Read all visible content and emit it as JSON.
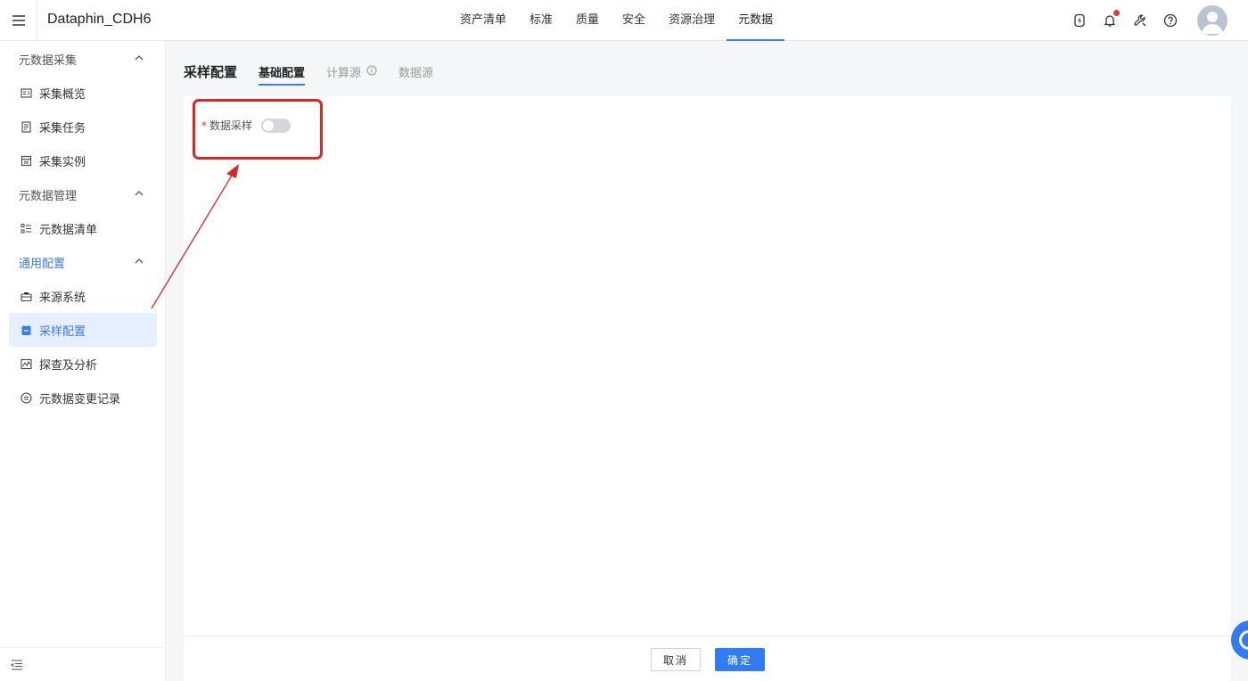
{
  "header": {
    "app_title": "Dataphin_CDH6",
    "nav": [
      {
        "label": "资产清单",
        "active": false
      },
      {
        "label": "标准",
        "active": false
      },
      {
        "label": "质量",
        "active": false
      },
      {
        "label": "安全",
        "active": false
      },
      {
        "label": "资源治理",
        "active": false
      },
      {
        "label": "元数据",
        "active": true
      }
    ],
    "icons": [
      "lightning-icon",
      "bell-icon",
      "wrench-icon",
      "help-icon",
      "avatar"
    ]
  },
  "sidebar": {
    "groups": [
      {
        "label": "元数据采集",
        "items": [
          "采集概览",
          "采集任务",
          "采集实例"
        ]
      },
      {
        "label": "元数据管理",
        "items": [
          "元数据清单"
        ]
      },
      {
        "label": "通用配置",
        "items": [
          "来源系统",
          "采样配置",
          "探查及分析",
          "元数据变更记录"
        ]
      }
    ],
    "active_item": "采样配置"
  },
  "main": {
    "title": "采样配置",
    "tabs": [
      {
        "label": "基础配置",
        "active": true
      },
      {
        "label": "计算源",
        "active": false,
        "info": true
      },
      {
        "label": "数据源",
        "active": false
      }
    ],
    "form": {
      "required_mark": "*",
      "label": "数据采样",
      "switch_on": false
    }
  },
  "footer": {
    "cancel_label": "取消",
    "confirm_label": "确定"
  },
  "colors": {
    "accent": "#3b7bf0",
    "primary_button": "#2f7cf6",
    "annotation": "#e02424"
  }
}
